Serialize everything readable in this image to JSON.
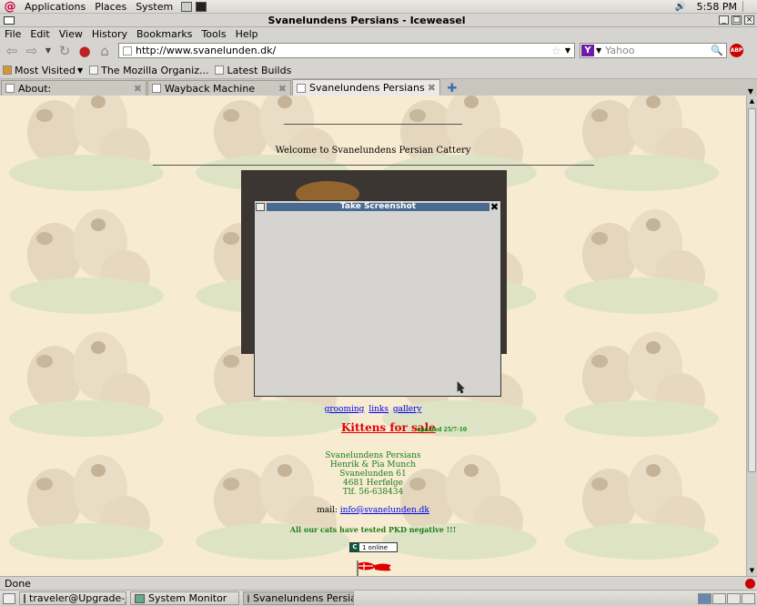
{
  "panel": {
    "menus": [
      "Applications",
      "Places",
      "System"
    ],
    "clock": "5:58 PM"
  },
  "window": {
    "title": "Svanelundens Persians - Iceweasel"
  },
  "menubar": [
    "File",
    "Edit",
    "View",
    "History",
    "Bookmarks",
    "Tools",
    "Help"
  ],
  "navbar": {
    "url": "http://www.svanelunden.dk/",
    "search_placeholder": "Yahoo",
    "search_engine_letter": "Y",
    "adblock_label": "ABP"
  },
  "bookmarks": [
    "Most Visited",
    "The Mozilla Organiz...",
    "Latest Builds"
  ],
  "tabs": [
    {
      "label": "About:"
    },
    {
      "label": "Wayback Machine"
    },
    {
      "label": "Svanelundens Persians"
    }
  ],
  "page": {
    "welcome": "Welcome to Svanelundens Persian Cattery",
    "links": [
      "grooming",
      "links",
      "gallery"
    ],
    "kittens": "Kittens for sale",
    "updated": "updated 25/7-10",
    "address": [
      "Svanelundens Persians",
      "Henrik & Pia Munch",
      "Svanelunden 61",
      "4681 Herfølge",
      "Tlf. 56-638434"
    ],
    "mail_label": "mail:",
    "mail_link": "info@svanelunden.dk",
    "pkd": "All our cats have tested PKD negative !!!",
    "online_letter": "C",
    "online": "1 online"
  },
  "dialog": {
    "title": "Take Screenshot"
  },
  "status": {
    "text": "Done"
  },
  "taskbar": {
    "tasks": [
      "traveler@Upgrade-Jou...",
      "System Monitor",
      "Svanelundens Persian..."
    ]
  },
  "colors": {
    "page_bg": "#f7ecd2",
    "address_green": "#1c7d1c",
    "kittens_red": "#e00000",
    "dialog_title": "#4c6a91"
  }
}
